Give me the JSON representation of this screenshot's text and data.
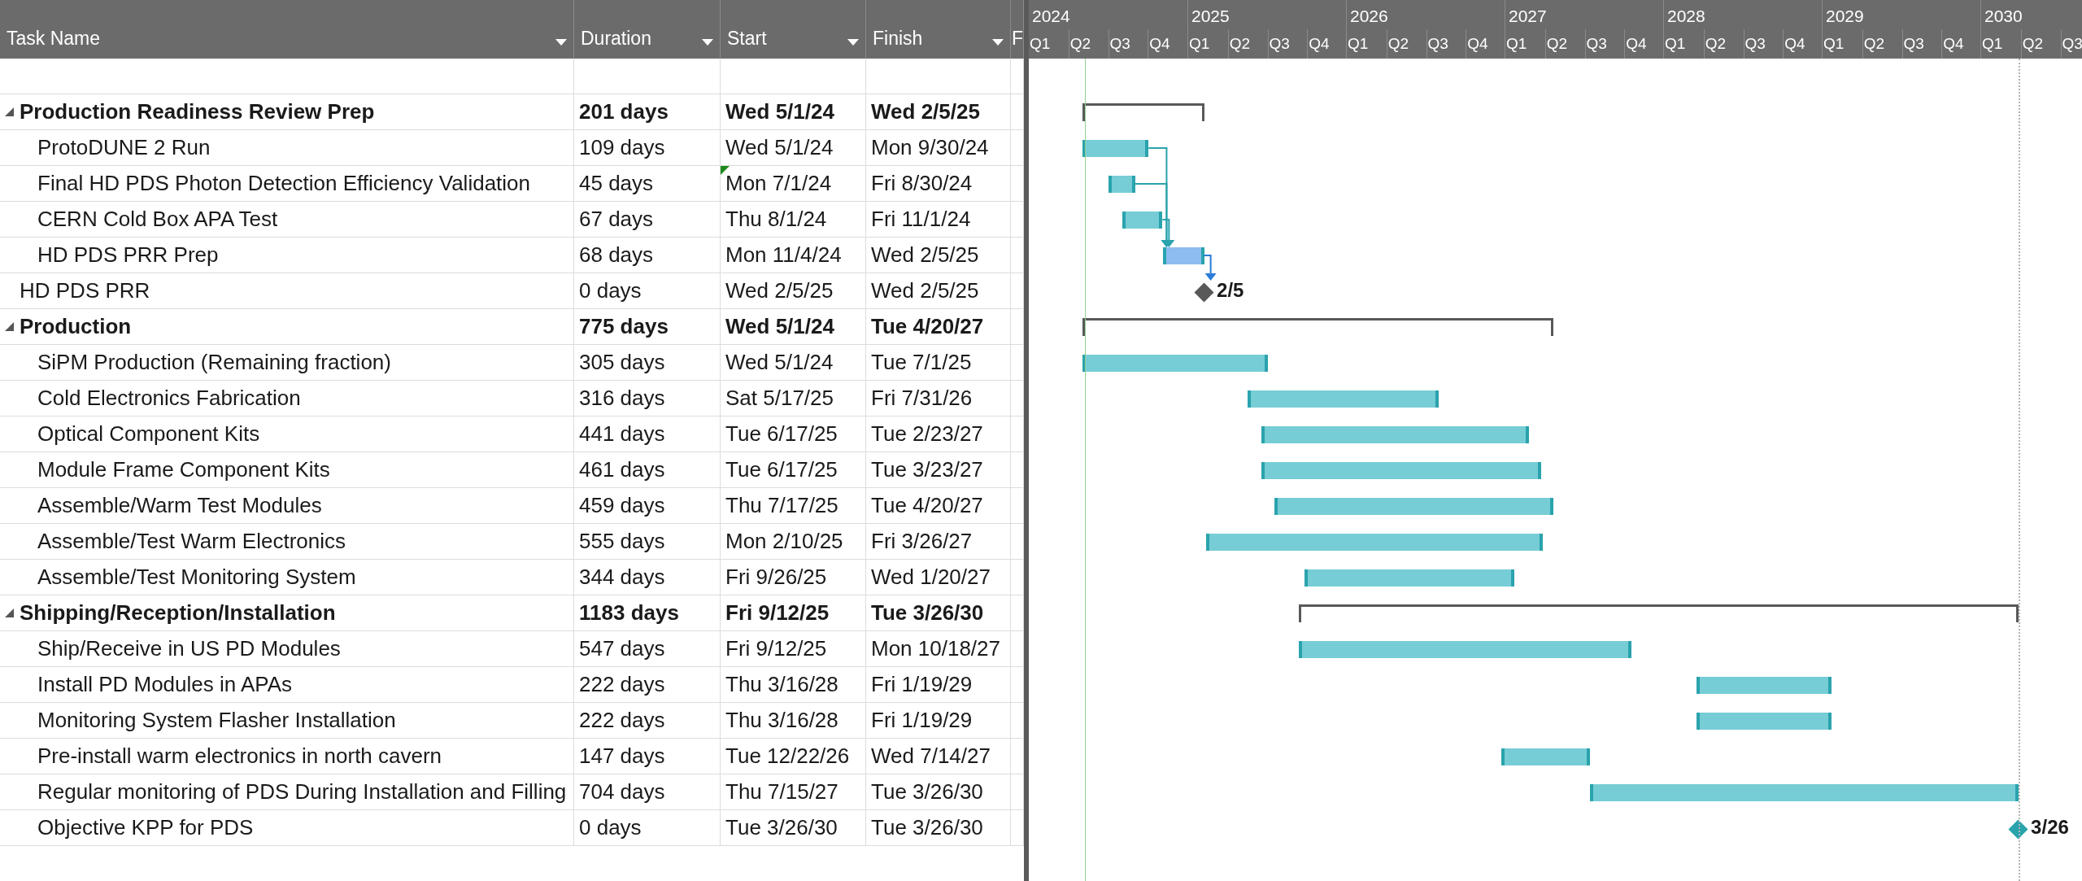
{
  "columns": [
    {
      "label": "Task Name",
      "has_menu": true
    },
    {
      "label": "Duration",
      "has_menu": true
    },
    {
      "label": "Start",
      "has_menu": true
    },
    {
      "label": "Finish",
      "has_menu": true
    },
    {
      "label": "F",
      "has_menu": false
    }
  ],
  "timescale": {
    "years": [
      {
        "label": "2024",
        "quarters": [
          "Q1",
          "Q2",
          "Q3",
          "Q4"
        ]
      },
      {
        "label": "2025",
        "quarters": [
          "Q1",
          "Q2",
          "Q3",
          "Q4"
        ]
      },
      {
        "label": "2026",
        "quarters": [
          "Q1",
          "Q2",
          "Q3",
          "Q4"
        ]
      },
      {
        "label": "2027",
        "quarters": [
          "Q1",
          "Q2",
          "Q3",
          "Q4"
        ]
      },
      {
        "label": "2028",
        "quarters": [
          "Q1",
          "Q2",
          "Q3",
          "Q4"
        ]
      },
      {
        "label": "2029",
        "quarters": [
          "Q1",
          "Q2",
          "Q3",
          "Q4"
        ]
      },
      {
        "label": "2030",
        "quarters": [
          "Q1",
          "Q2",
          "Q3"
        ]
      }
    ]
  },
  "tasks": [
    {
      "kind": "summary",
      "name": "Production Readiness Review Prep",
      "duration": "201 days",
      "start": "Wed 5/1/24",
      "finish": "Wed 2/5/25",
      "expanded": true,
      "start_flagged": false,
      "children": [
        {
          "kind": "task",
          "name": "ProtoDUNE 2 Run",
          "duration": "109 days",
          "start": "Wed 5/1/24",
          "finish": "Mon 9/30/24",
          "color": "#76cdd5",
          "start_flagged": false
        },
        {
          "kind": "task",
          "name": "Final HD PDS Photon Detection Efficiency Validation",
          "duration": "45 days",
          "start": "Mon 7/1/24",
          "finish": "Fri 8/30/24",
          "color": "#76cdd5",
          "start_flagged": true
        },
        {
          "kind": "task",
          "name": "CERN Cold Box APA Test",
          "duration": "67 days",
          "start": "Thu 8/1/24",
          "finish": "Fri 11/1/24",
          "color": "#76cdd5",
          "start_flagged": false
        },
        {
          "kind": "task",
          "name": "HD PDS PRR Prep",
          "duration": "68 days",
          "start": "Mon 11/4/24",
          "finish": "Wed 2/5/25",
          "color": "#8dbdf0",
          "start_flagged": false
        }
      ]
    },
    {
      "kind": "milestone",
      "name": "HD PDS PRR",
      "duration": "0 days",
      "start": "Wed 2/5/25",
      "finish": "Wed 2/5/25",
      "label": "2/5",
      "color": "#595959",
      "start_flagged": false
    },
    {
      "kind": "summary",
      "name": "Production",
      "duration": "775 days",
      "start": "Wed 5/1/24",
      "finish": "Tue 4/20/27",
      "expanded": true,
      "start_flagged": false,
      "children": [
        {
          "kind": "task",
          "name": "SiPM Production (Remaining fraction)",
          "duration": "305 days",
          "start": "Wed 5/1/24",
          "finish": "Tue 7/1/25",
          "color": "#76cdd5",
          "start_flagged": false
        },
        {
          "kind": "task",
          "name": "Cold Electronics Fabrication",
          "duration": "316 days",
          "start": "Sat 5/17/25",
          "finish": "Fri 7/31/26",
          "color": "#76cdd5",
          "start_flagged": false
        },
        {
          "kind": "task",
          "name": "Optical Component Kits",
          "duration": "441 days",
          "start": "Tue 6/17/25",
          "finish": "Tue 2/23/27",
          "color": "#76cdd5",
          "start_flagged": false
        },
        {
          "kind": "task",
          "name": "Module Frame Component Kits",
          "duration": "461 days",
          "start": "Tue 6/17/25",
          "finish": "Tue 3/23/27",
          "color": "#76cdd5",
          "start_flagged": false
        },
        {
          "kind": "task",
          "name": "Assemble/Warm Test Modules",
          "duration": "459 days",
          "start": "Thu 7/17/25",
          "finish": "Tue 4/20/27",
          "color": "#76cdd5",
          "start_flagged": false
        },
        {
          "kind": "task",
          "name": "Assemble/Test Warm Electronics",
          "duration": "555 days",
          "start": "Mon 2/10/25",
          "finish": "Fri 3/26/27",
          "color": "#76cdd5",
          "start_flagged": false
        },
        {
          "kind": "task",
          "name": "Assemble/Test Monitoring System",
          "duration": "344 days",
          "start": "Fri 9/26/25",
          "finish": "Wed 1/20/27",
          "color": "#76cdd5",
          "start_flagged": false
        }
      ]
    },
    {
      "kind": "summary",
      "name": "Shipping/Reception/Installation",
      "duration": "1183 days",
      "start": "Fri 9/12/25",
      "finish": "Tue 3/26/30",
      "expanded": true,
      "start_flagged": false,
      "children": [
        {
          "kind": "task",
          "name": "Ship/Receive in US PD Modules",
          "duration": "547 days",
          "start": "Fri 9/12/25",
          "finish": "Mon 10/18/27",
          "color": "#76cdd5",
          "start_flagged": false
        },
        {
          "kind": "task",
          "name": "Install PD Modules in APAs",
          "duration": "222 days",
          "start": "Thu 3/16/28",
          "finish": "Fri 1/19/29",
          "color": "#76cdd5",
          "start_flagged": false
        },
        {
          "kind": "task",
          "name": "Monitoring System Flasher Installation",
          "duration": "222 days",
          "start": "Thu 3/16/28",
          "finish": "Fri 1/19/29",
          "color": "#76cdd5",
          "start_flagged": false
        },
        {
          "kind": "task",
          "name": "Pre-install warm electronics in north cavern",
          "duration": "147 days",
          "start": "Tue 12/22/26",
          "finish": "Wed 7/14/27",
          "color": "#76cdd5",
          "start_flagged": false
        },
        {
          "kind": "task",
          "name": "Regular monitoring of PDS During Installation and Filling",
          "duration": "704 days",
          "start": "Thu 7/15/27",
          "finish": "Tue 3/26/30",
          "color": "#76cdd5",
          "start_flagged": false
        },
        {
          "kind": "milestone",
          "name": "Objective KPP for PDS",
          "duration": "0 days",
          "start": "Tue 3/26/30",
          "finish": "Tue 3/26/30",
          "label": "3/26",
          "color": "#2aa3ad",
          "start_flagged": false
        }
      ]
    }
  ]
}
